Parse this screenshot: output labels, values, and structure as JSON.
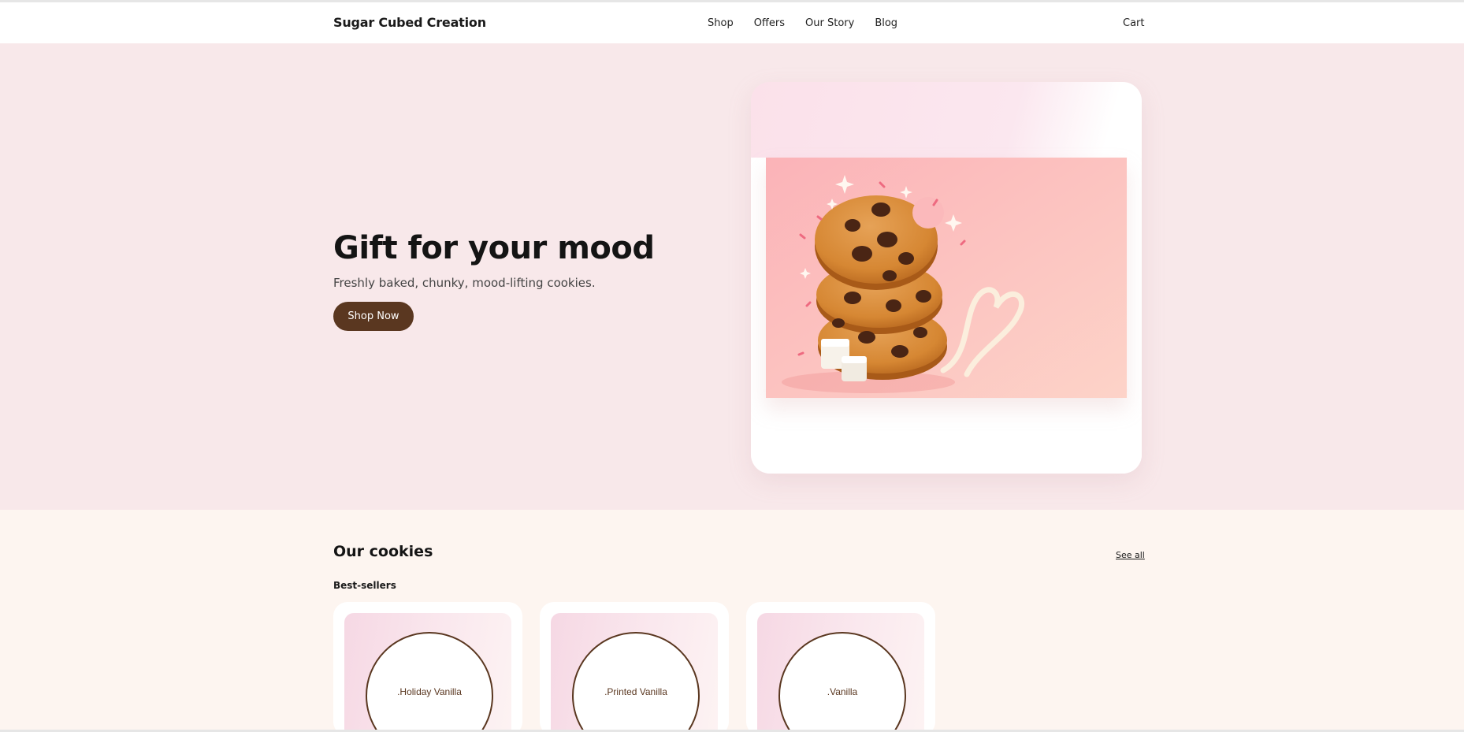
{
  "header": {
    "brand": "Sugar Cubed Creation",
    "nav": [
      "Shop",
      "Offers",
      "Our Story",
      "Blog"
    ],
    "cart": "Cart"
  },
  "hero": {
    "title": "Gift for your mood",
    "subtitle": "Freshly baked, chunky, mood-lifting cookies.",
    "cta": "Shop Now"
  },
  "cookies": {
    "title": "Our cookies",
    "see_all": "See all",
    "subsection": "Best-sellers",
    "products": [
      {
        "name": ".Holiday Vanilla"
      },
      {
        "name": ".Printed Vanilla"
      },
      {
        "name": ".Vanilla"
      }
    ]
  },
  "colors": {
    "brand_brown": "#5a3720",
    "hero_bg": "#f8e8ea",
    "section_bg": "#fdf5f0"
  }
}
